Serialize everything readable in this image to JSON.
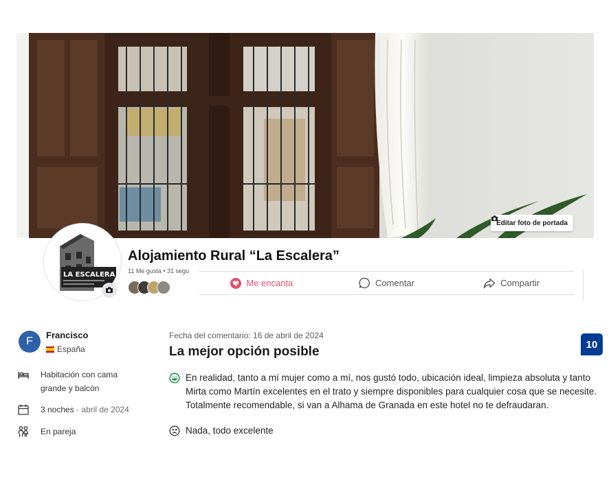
{
  "cover": {
    "edit_label": "Editar foto de portada"
  },
  "page": {
    "name": "Alojamiento Rural “La Escalera”",
    "likes_line": "11 Me gusta • 31 segu",
    "avatar_logo_text": "LA ESCALERA"
  },
  "actions": {
    "love": "Me encanta",
    "comment": "Comentar",
    "share": "Compartir"
  },
  "review": {
    "reviewer_initial": "F",
    "reviewer_name": "Francisco",
    "reviewer_country": "España",
    "room_type": "Habitación con cama grande y balcón",
    "nights": "3 noches",
    "stay_date": "abril de 2024",
    "traveller_type": "En pareja",
    "comment_date": "Fecha del comentario: 16 de abril de 2024",
    "title": "La mejor opción posible",
    "score": "10",
    "positive_text": "En realidad, tanto a mí mujer como a mí, nos gustó todo, ubicación ideal, limpieza absoluta y tanto Mirta como Martín excelentes en el trato y siempre disponibles para cualquier cosa que se necesite. Totalmente recomendable, si van a Alhama de Granada en este hotel no te defraudaran.",
    "negative_text": "Nada, todo excelente"
  },
  "colors": {
    "love": "#e8506b",
    "score_bg": "#003b95",
    "avatar_bg": "#2e61a8",
    "positive_icon": "#008234"
  },
  "icons": {
    "camera": "camera-icon",
    "heart": "heart-icon",
    "comment": "comment-icon",
    "share": "share-icon",
    "bed": "bed-icon",
    "calendar": "calendar-icon",
    "couple": "couple-icon",
    "smile": "smile-icon",
    "frown": "frown-icon"
  }
}
